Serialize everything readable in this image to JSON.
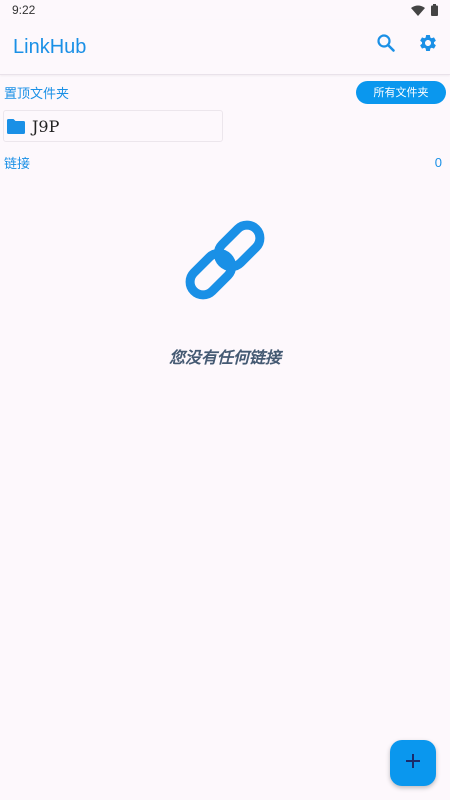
{
  "status_bar": {
    "time": "9:22",
    "icons": [
      "wifi-icon",
      "battery-icon"
    ]
  },
  "app_bar": {
    "title": "LinkHub",
    "actions": [
      "search-icon",
      "settings-icon"
    ]
  },
  "pinned_section": {
    "label": "置顶文件夹",
    "all_folders_button": "所有文件夹",
    "folders": [
      {
        "name": "J9P",
        "icon": "folder-icon"
      }
    ]
  },
  "links_section": {
    "label": "链接",
    "count": "0"
  },
  "empty_state": {
    "icon": "link-icon",
    "message": "您没有任何链接"
  },
  "fab": {
    "icon": "plus-icon"
  },
  "colors": {
    "accent": "#1a90e6",
    "button_bg": "#0a97ee",
    "background": "#fdf8fc",
    "empty_text": "#455a73"
  }
}
